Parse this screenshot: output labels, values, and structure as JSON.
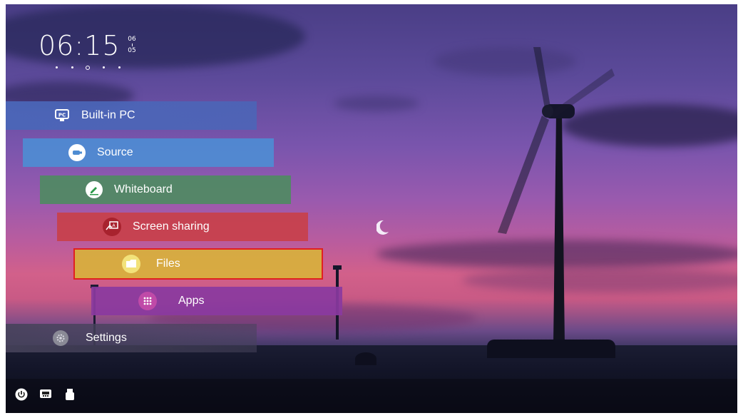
{
  "clock": {
    "time": "06:15",
    "date_month": "06",
    "date_day": "05"
  },
  "menu": {
    "items": [
      {
        "label": "Built-in PC",
        "icon": "pc-icon",
        "color": "#4a66b8"
      },
      {
        "label": "Source",
        "icon": "source-icon",
        "color": "#4e8cd2"
      },
      {
        "label": "Whiteboard",
        "icon": "pencil-icon",
        "color": "#4f8a62"
      },
      {
        "label": "Screen sharing",
        "icon": "screen-share-icon",
        "color": "#c8404a"
      },
      {
        "label": "Files",
        "icon": "folder-icon",
        "color": "#d8b23a"
      },
      {
        "label": "Apps",
        "icon": "apps-grid-icon",
        "color": "#8a3aa0"
      },
      {
        "label": "Settings",
        "icon": "gear-icon",
        "color": "#55506a"
      }
    ]
  },
  "bottom_bar": {
    "icons": [
      "power-icon",
      "network-icon",
      "usb-icon"
    ]
  },
  "colors": {
    "selection_outline": "#e02020"
  }
}
